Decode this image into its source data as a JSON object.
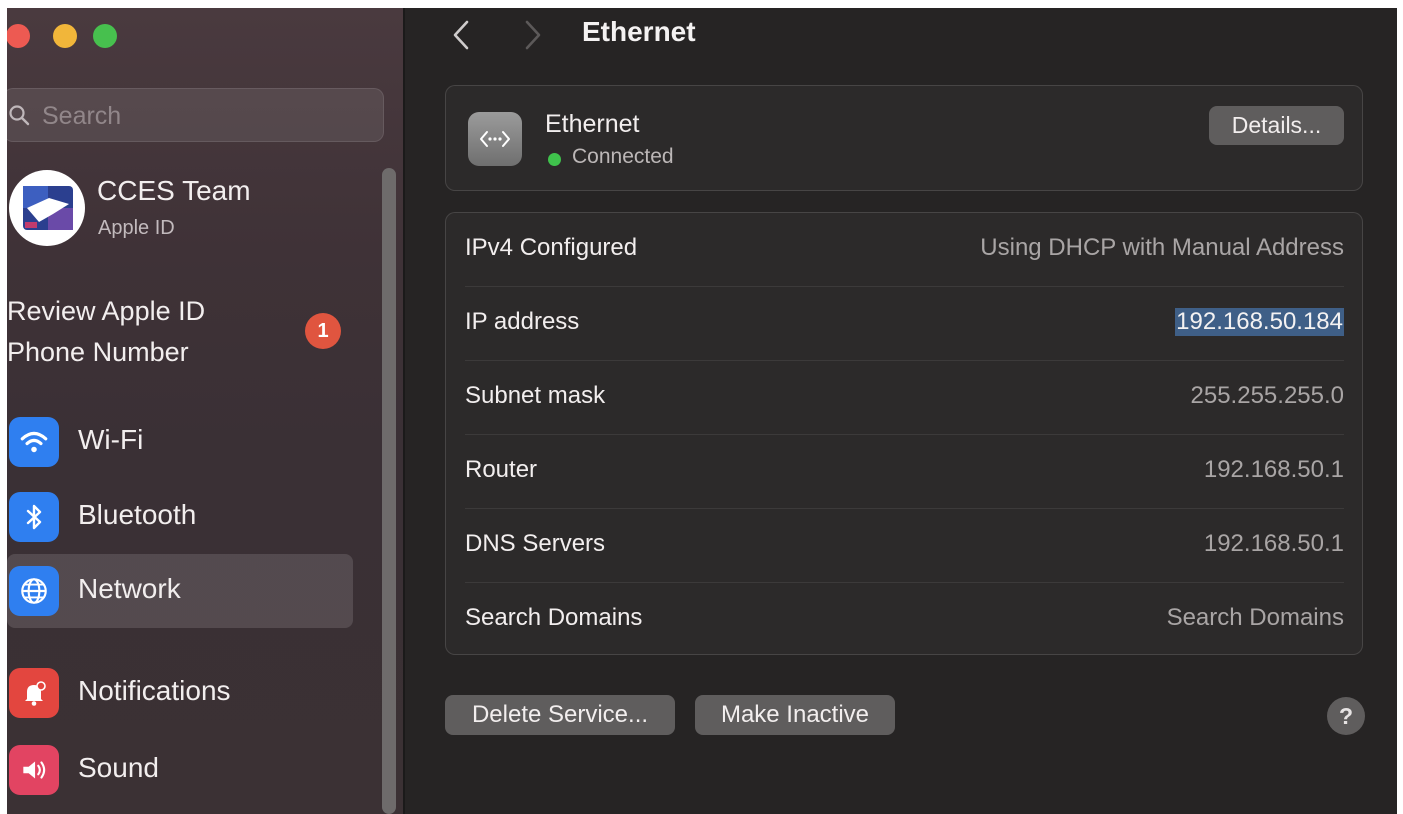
{
  "window": {
    "traffic_lights": [
      "close",
      "minimize",
      "zoom"
    ]
  },
  "sidebar": {
    "search": {
      "placeholder": "Search",
      "value": ""
    },
    "account": {
      "name": "CCES Team",
      "subtitle": "Apple ID"
    },
    "review": {
      "line1": "Review Apple ID",
      "line2": "Phone Number",
      "badge_count": "1"
    },
    "items": [
      {
        "label": "Wi-Fi",
        "icon": "wifi-icon",
        "color": "#2f7ff0"
      },
      {
        "label": "Bluetooth",
        "icon": "bluetooth-icon",
        "color": "#2f7ff0"
      },
      {
        "label": "Network",
        "icon": "globe-icon",
        "color": "#2f7ff0",
        "selected": true
      },
      {
        "label": "Notifications",
        "icon": "bell-icon",
        "color": "#e3463f"
      },
      {
        "label": "Sound",
        "icon": "speaker-icon",
        "color": "#e24462"
      }
    ]
  },
  "header": {
    "title": "Ethernet"
  },
  "service": {
    "name": "Ethernet",
    "status": "Connected",
    "status_color": "#3fc24c",
    "details_label": "Details..."
  },
  "info_rows": [
    {
      "label": "IPv4 Configured",
      "value": "Using DHCP with Manual Address"
    },
    {
      "label": "IP address",
      "value": "192.168.50.184",
      "selected": true
    },
    {
      "label": "Subnet mask",
      "value": "255.255.255.0"
    },
    {
      "label": "Router",
      "value": "192.168.50.1"
    },
    {
      "label": "DNS Servers",
      "value": "192.168.50.1"
    },
    {
      "label": "Search Domains",
      "value": "Search Domains"
    }
  ],
  "actions": {
    "delete_label": "Delete Service...",
    "inactive_label": "Make Inactive",
    "help_label": "?"
  }
}
